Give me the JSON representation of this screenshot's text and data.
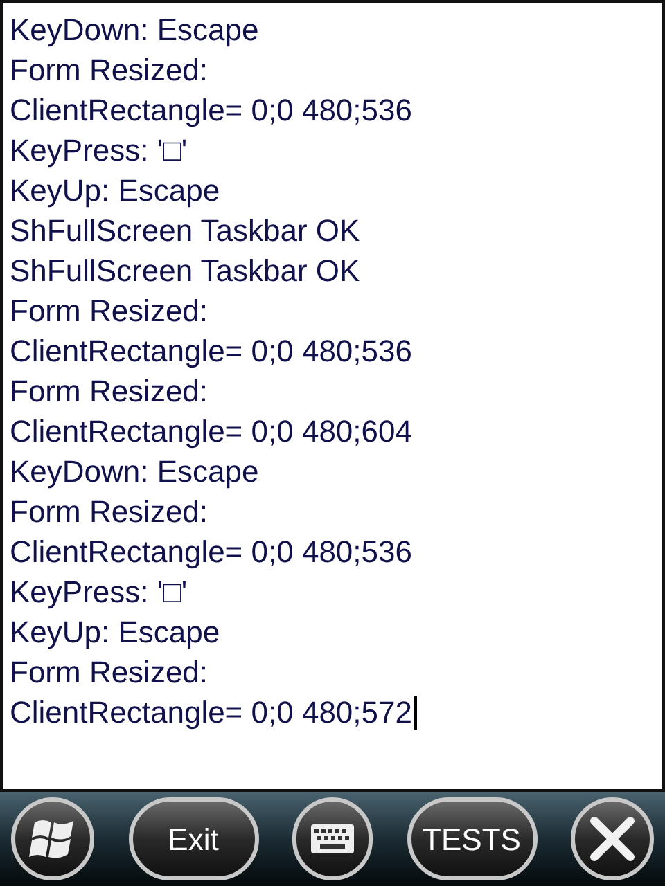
{
  "log": {
    "lines": [
      "KeyDown: Escape",
      "Form Resized:",
      "ClientRectangle= 0;0 480;536",
      "KeyPress: '□'",
      "KeyUp: Escape",
      "ShFullScreen Taskbar OK",
      "ShFullScreen Taskbar OK",
      "Form Resized:",
      "ClientRectangle= 0;0 480;536",
      "Form Resized:",
      "ClientRectangle= 0;0 480;604",
      "KeyDown: Escape",
      "Form Resized:",
      "ClientRectangle= 0;0 480;536",
      "KeyPress: '□'",
      "KeyUp: Escape",
      "Form Resized:",
      "ClientRectangle= 0;0 480;572"
    ],
    "caret": true
  },
  "taskbar": {
    "buttons": [
      {
        "kind": "start"
      },
      {
        "kind": "text",
        "label": "Exit"
      },
      {
        "kind": "keyboard"
      },
      {
        "kind": "text",
        "label": "TESTS"
      },
      {
        "kind": "close"
      }
    ]
  }
}
